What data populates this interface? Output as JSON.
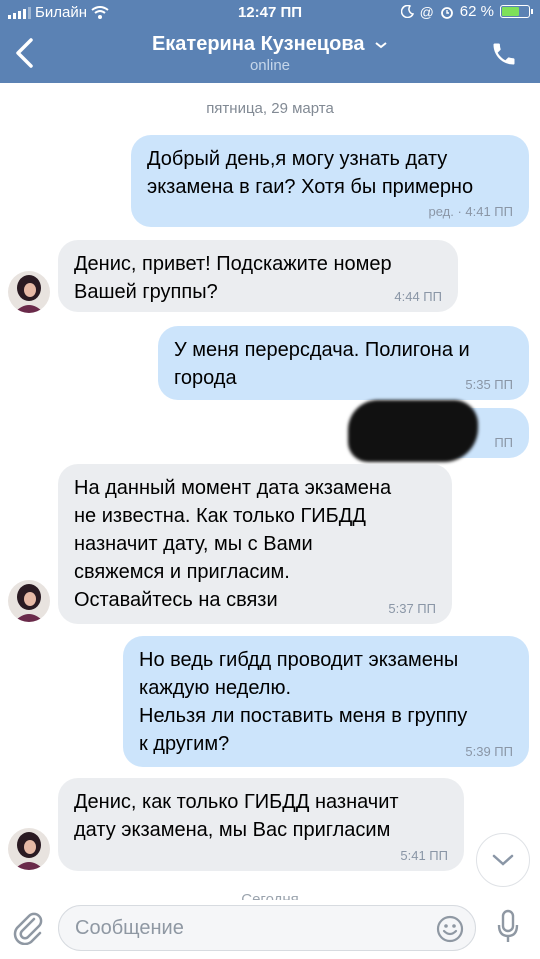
{
  "status_bar": {
    "carrier": "Билайн",
    "time": "12:47 ПП",
    "battery_text": "62 %",
    "battery_level": 0.62
  },
  "header": {
    "title": "Екатерина Кузнецова",
    "subtitle": "online",
    "background": "#5b82b4"
  },
  "chat": {
    "date_separator": "пятница, 29 марта",
    "messages": [
      {
        "dir": "out",
        "lines": [
          "Добрый день,я могу узнать дату",
          "экзамена в гаи? Хотя бы примерно"
        ],
        "time": "ред. · 4:41 ПП"
      },
      {
        "dir": "in",
        "lines": [
          "Денис, привет! Подскажите номер",
          "Вашей группы?"
        ],
        "time": "4:44 ПП"
      },
      {
        "dir": "out",
        "lines": [
          "У меня перерсдача. Полигона и",
          "города"
        ],
        "time": "5:35 ПП"
      },
      {
        "dir": "out",
        "lines": [
          ""
        ],
        "time": "ПП",
        "redacted": true
      },
      {
        "dir": "in",
        "lines": [
          "На данный момент дата экзамена",
          "не известна. Как только ГИБДД",
          "назначит дату, мы с Вами",
          "свяжемся и пригласим.",
          "Оставайтесь на связи"
        ],
        "time": "5:37 ПП"
      },
      {
        "dir": "out",
        "lines": [
          "Но ведь гибдд проводит экзамены",
          "каждую неделю.",
          "Нельзя ли поставить меня в группу",
          "к другим?"
        ],
        "time": "5:39 ПП"
      },
      {
        "dir": "in",
        "lines": [
          "Денис, как только ГИБДД назначит",
          "дату экзамена, мы Вас пригласим"
        ],
        "time": "5:41 ПП"
      }
    ],
    "today_separator": "Сегодня"
  },
  "composer": {
    "placeholder": "Сообщение"
  },
  "colors": {
    "outgoing_bubble": "#cce4fb",
    "incoming_bubble": "#ebedf0"
  },
  "icons": [
    "signal-icon",
    "wifi-icon",
    "back-arrow-icon",
    "chevron-down-icon",
    "phone-icon",
    "moon-icon",
    "at-icon",
    "alarm-icon",
    "battery-icon",
    "attach-icon",
    "smile-icon",
    "mic-icon",
    "scroll-down-icon"
  ]
}
